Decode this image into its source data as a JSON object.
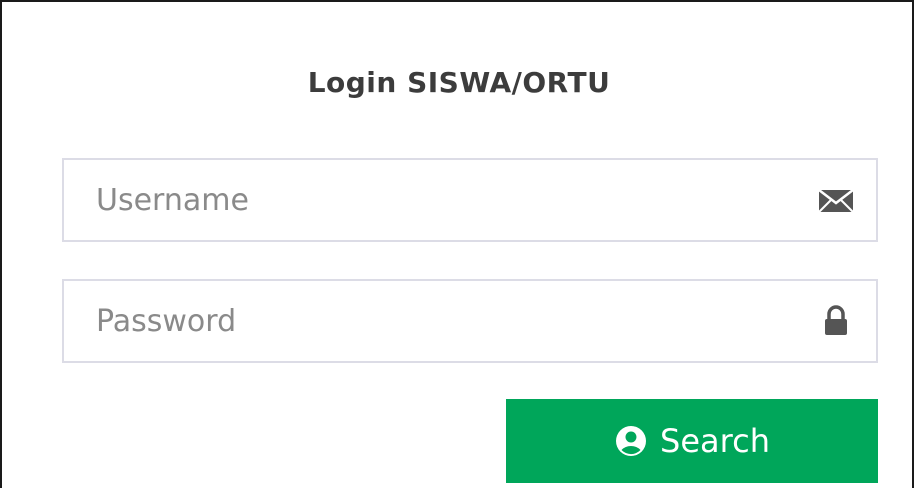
{
  "form": {
    "title": "Login SISWA/ORTU",
    "username": {
      "placeholder": "Username",
      "value": "",
      "icon": "envelope-icon"
    },
    "password": {
      "placeholder": "Password",
      "value": "",
      "icon": "lock-icon"
    },
    "submit": {
      "label": "Search",
      "icon": "user-circle-icon"
    }
  },
  "colors": {
    "accent": "#00a65a",
    "title_text": "#3c3c3c",
    "field_border": "#dcdce6",
    "icon": "#555555",
    "placeholder": "#8a8a8a"
  }
}
